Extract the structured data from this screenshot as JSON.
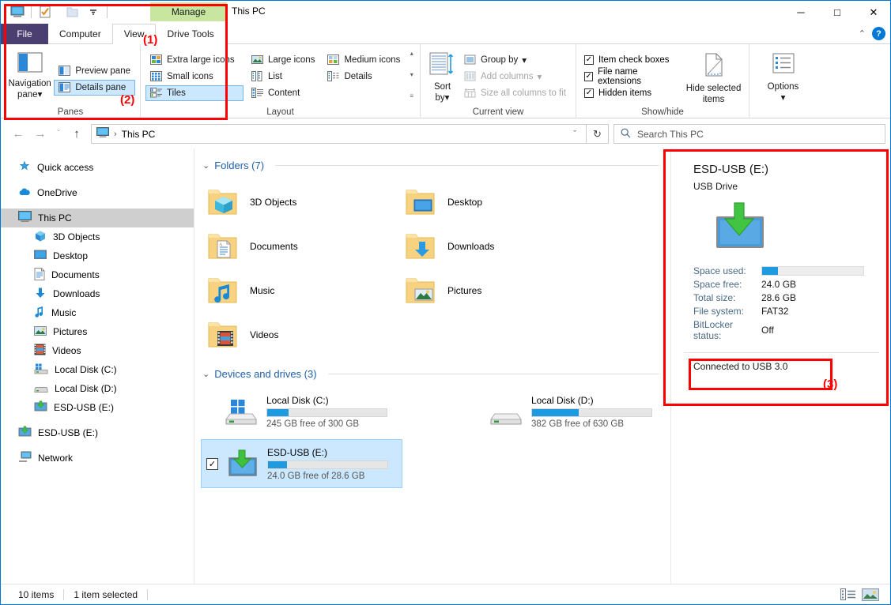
{
  "window": {
    "title": "This PC",
    "minimize_label": "─",
    "maximize_label": "□",
    "close_label": "✕",
    "collapse_ribbon_label": "⌃",
    "help_label": "?"
  },
  "quick_access_toolbar": {
    "items": [
      {
        "name": "this-pc-icon",
        "label": "This PC"
      },
      {
        "name": "properties-icon",
        "label": "Properties"
      },
      {
        "name": "new-folder-icon",
        "label": "New folder"
      },
      {
        "name": "customize-dropdown-icon",
        "label": "▾"
      }
    ]
  },
  "contextual_tab_header": {
    "label": "Manage"
  },
  "ribbon_tabs": [
    {
      "label": "File",
      "state": "file"
    },
    {
      "label": "Computer",
      "state": "normal"
    },
    {
      "label": "View",
      "state": "active"
    },
    {
      "label": "Drive Tools",
      "state": "contextual"
    }
  ],
  "ribbon": {
    "groups": [
      {
        "label": "Panes",
        "big_button": {
          "label_line1": "Navigation",
          "label_line2": "pane",
          "icon": "navigation-pane-icon",
          "caret": "▾"
        },
        "small_buttons": [
          {
            "label": "Preview pane",
            "icon": "preview-pane-icon",
            "state": "normal"
          },
          {
            "label": "Details pane",
            "icon": "details-pane-icon",
            "state": "selected"
          }
        ]
      },
      {
        "label": "Layout",
        "columns": [
          [
            {
              "label": "Extra large icons",
              "icon": "extra-large-icons-icon",
              "state": "normal"
            },
            {
              "label": "Small icons",
              "icon": "small-icons-icon",
              "state": "normal"
            },
            {
              "label": "Tiles",
              "icon": "tiles-icon",
              "state": "selected"
            }
          ],
          [
            {
              "label": "Large icons",
              "icon": "large-icons-icon",
              "state": "normal"
            },
            {
              "label": "List",
              "icon": "list-icon",
              "state": "normal"
            },
            {
              "label": "Content",
              "icon": "content-icon",
              "state": "normal"
            }
          ],
          [
            {
              "label": "Medium icons",
              "icon": "medium-icons-icon",
              "state": "normal"
            },
            {
              "label": "Details",
              "icon": "details-icon",
              "state": "normal"
            }
          ]
        ],
        "scroll": {
          "up": "▴",
          "down": "▾",
          "more": "≡"
        }
      },
      {
        "label": "Current view",
        "big_button": {
          "label_line1": "Sort",
          "label_line2": "by",
          "icon": "sort-by-icon",
          "caret": "▾"
        },
        "small_buttons": [
          {
            "label": "Group by",
            "icon": "group-by-icon",
            "state": "normal",
            "caret": "▾"
          },
          {
            "label": "Add columns",
            "icon": "add-columns-icon",
            "state": "disabled",
            "caret": "▾"
          },
          {
            "label": "Size all columns to fit",
            "icon": "size-columns-icon",
            "state": "disabled"
          }
        ]
      },
      {
        "label": "Show/hide",
        "checkboxes": [
          {
            "label": "Item check boxes",
            "checked": true
          },
          {
            "label": "File name extensions",
            "checked": true
          },
          {
            "label": "Hidden items",
            "checked": true
          }
        ],
        "big_button": {
          "label_line1": "Hide selected",
          "label_line2": "items",
          "icon": "hide-selected-items-icon"
        }
      },
      {
        "label": "",
        "big_button": {
          "label_line1": "Options",
          "label_line2": "",
          "icon": "options-icon",
          "caret": "▾"
        }
      }
    ]
  },
  "address_bar": {
    "back_icon": "←",
    "forward_icon": "→",
    "recent_icon": "ˇ",
    "up_icon": "↑",
    "breadcrumb_icon": "this-pc-icon",
    "breadcrumb_separator": "›",
    "breadcrumb": "This PC",
    "dropdown_icon": "ˇ",
    "refresh_icon": "↻",
    "search_icon": "search-icon",
    "search_placeholder": "Search This PC",
    "search_value": ""
  },
  "navigation_pane": {
    "items": [
      {
        "label": "Quick access",
        "icon": "quick-access-star-icon",
        "level": 0,
        "selected": false,
        "gap_after": true
      },
      {
        "label": "OneDrive",
        "icon": "onedrive-cloud-icon",
        "level": 0,
        "selected": false,
        "gap_after": true
      },
      {
        "label": "This PC",
        "icon": "this-pc-icon",
        "level": 0,
        "selected": true,
        "gap_after": false
      },
      {
        "label": "3D Objects",
        "icon": "3d-objects-icon",
        "level": 1,
        "selected": false,
        "gap_after": false
      },
      {
        "label": "Desktop",
        "icon": "desktop-icon",
        "level": 1,
        "selected": false,
        "gap_after": false
      },
      {
        "label": "Documents",
        "icon": "documents-icon",
        "level": 1,
        "selected": false,
        "gap_after": false
      },
      {
        "label": "Downloads",
        "icon": "downloads-icon",
        "level": 1,
        "selected": false,
        "gap_after": false
      },
      {
        "label": "Music",
        "icon": "music-icon",
        "level": 1,
        "selected": false,
        "gap_after": false
      },
      {
        "label": "Pictures",
        "icon": "pictures-icon",
        "level": 1,
        "selected": false,
        "gap_after": false
      },
      {
        "label": "Videos",
        "icon": "videos-icon",
        "level": 1,
        "selected": false,
        "gap_after": false
      },
      {
        "label": "Local Disk (C:)",
        "icon": "windows-drive-icon",
        "level": 1,
        "selected": false,
        "gap_after": false
      },
      {
        "label": "Local Disk (D:)",
        "icon": "drive-icon",
        "level": 1,
        "selected": false,
        "gap_after": false
      },
      {
        "label": "ESD-USB (E:)",
        "icon": "usb-drive-icon",
        "level": 1,
        "selected": false,
        "gap_after": true
      },
      {
        "label": "ESD-USB (E:)",
        "icon": "usb-drive-icon",
        "level": 0,
        "selected": false,
        "gap_after": true
      },
      {
        "label": "Network",
        "icon": "network-icon",
        "level": 0,
        "selected": false,
        "gap_after": false
      }
    ]
  },
  "file_list": {
    "groups": [
      {
        "name": "folders",
        "chevron": "⌄",
        "title": "Folders (7)",
        "items": [
          {
            "label": "3D Objects",
            "icon": "folder-3d-objects-icon"
          },
          {
            "label": "Desktop",
            "icon": "folder-desktop-icon"
          },
          {
            "label": "Documents",
            "icon": "folder-documents-icon"
          },
          {
            "label": "Downloads",
            "icon": "folder-downloads-icon"
          },
          {
            "label": "Music",
            "icon": "folder-music-icon"
          },
          {
            "label": "Pictures",
            "icon": "folder-pictures-icon"
          },
          {
            "label": "Videos",
            "icon": "folder-videos-icon"
          }
        ]
      },
      {
        "name": "devices-and-drives",
        "chevron": "⌄",
        "title": "Devices and drives (3)",
        "drives": [
          {
            "label": "Local Disk (C:)",
            "icon": "windows-drive-icon",
            "capacity_text": "245 GB free of 300 GB",
            "used_percent": 18,
            "selected": false,
            "checked": false
          },
          {
            "label": "Local Disk (D:)",
            "icon": "drive-icon",
            "capacity_text": "382 GB free of 630 GB",
            "used_percent": 39,
            "selected": false,
            "checked": false
          },
          {
            "label": "ESD-USB (E:)",
            "icon": "usb-drive-icon",
            "capacity_text": "24.0 GB free of 28.6 GB",
            "used_percent": 16,
            "selected": true,
            "checked": true
          }
        ]
      }
    ]
  },
  "details_pane": {
    "title": "ESD-USB (E:)",
    "subtitle": "USB Drive",
    "icon": "usb-drive-large-icon",
    "properties": [
      {
        "key": "Space used:",
        "value": "",
        "bar": true,
        "used_percent": 16
      },
      {
        "key": "Space free:",
        "value": "24.0 GB",
        "bar": false
      },
      {
        "key": "Total size:",
        "value": "28.6 GB",
        "bar": false
      },
      {
        "key": "File system:",
        "value": "FAT32",
        "bar": false
      },
      {
        "key": "BitLocker status:",
        "value": "Off",
        "bar": false
      }
    ],
    "connection_status": "Connected to USB 3.0"
  },
  "status_bar": {
    "item_count": "10 items",
    "selection": "1 item selected",
    "view_buttons": [
      {
        "name": "details-view-button",
        "active": false
      },
      {
        "name": "large-icons-view-button",
        "active": true
      }
    ]
  },
  "annotations": [
    {
      "label": "(1)",
      "target": "ribbon-view-tab-region"
    },
    {
      "label": "(2)",
      "target": "details-pane-button"
    },
    {
      "label": "(3)",
      "target": "connection-status"
    }
  ],
  "colors": {
    "accent": "#0078d7",
    "file_tab": "#4b3f72",
    "contextual_tab": "#c8e6a0",
    "selection": "#cce8ff",
    "bar_fill": "#1e9ae0",
    "annotation": "#ff0000",
    "group_title": "#1f5fa9"
  }
}
